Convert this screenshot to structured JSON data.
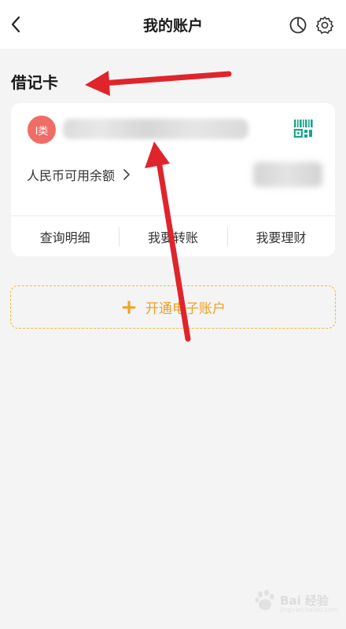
{
  "header": {
    "title": "我的账户"
  },
  "section": {
    "title": "借记卡"
  },
  "card": {
    "badge": "I类",
    "balance_label": "人民币可用余额",
    "actions": [
      "查询明细",
      "我要转账",
      "我要理财"
    ]
  },
  "open_account": {
    "label": "开通电子账户"
  },
  "watermark": {
    "text": "Bai 经验",
    "sub": "jingyan.baidu.com"
  },
  "colors": {
    "badge_red": "#f06c66",
    "accent_orange": "#f0a020",
    "qr_green": "#1aa58a",
    "annotation_arrow": "#e0242b"
  },
  "icons": [
    "back-icon",
    "pie-chart-icon",
    "settings-gear-icon",
    "qr-scan-icon",
    "chevron-right-icon",
    "plus-icon"
  ]
}
